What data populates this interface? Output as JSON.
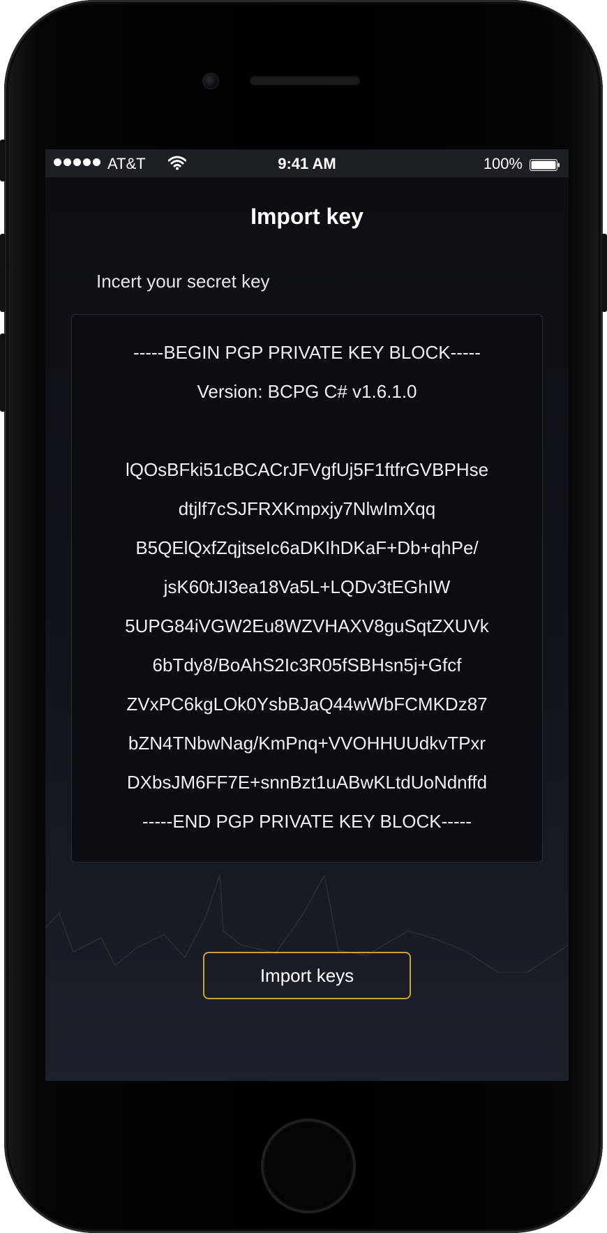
{
  "status_bar": {
    "carrier": "AT&T",
    "time": "9:41 AM",
    "battery": "100%",
    "signal_icon": "signal-dots-icon",
    "wifi_icon": "wifi-icon",
    "battery_icon": "battery-icon"
  },
  "screen": {
    "title": "Import key",
    "key_label": "Incert your secret key",
    "key_lines": [
      "-----BEGIN PGP PRIVATE KEY BLOCK-----",
      "Version: BCPG C# v1.6.1.0",
      "",
      "lQOsBFki51cBCACrJFVgfUj5F1ftfrGVBPHse",
      "dtjlf7cSJFRXKmpxjy7NlwImXqq",
      "B5QElQxfZqjtseIc6aDKIhDKaF+Db+qhPe/",
      "jsK60tJI3ea18Va5L+LQDv3tEGhIW",
      "5UPG84iVGW2Eu8WZVHAXV8guSqtZXUVk",
      "6bTdy8/BoAhS2Ic3R05fSBHsn5j+Gfcf",
      "ZVxPC6kgLOk0YsbBJaQ44wWbFCMKDz87",
      "bZN4TNbwNag/KmPnq+VVOHHUUdkvTPxr",
      "DXbsJM6FF7E+snnBzt1uABwKLtdUoNdnffd",
      "-----END PGP PRIVATE KEY BLOCK-----"
    ],
    "import_button": "Import keys",
    "accent_color": "#c9a23b"
  }
}
